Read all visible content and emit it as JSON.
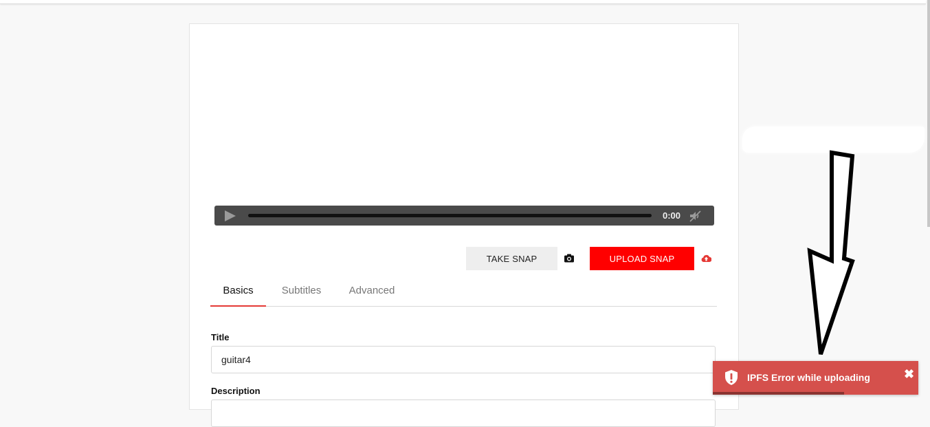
{
  "player": {
    "time": "0:00"
  },
  "actions": {
    "take_snap_label": "TAKE SNAP",
    "upload_snap_label": "UPLOAD SNAP",
    "take_snap_icon": "camera-icon",
    "upload_snap_icon": "cloud-upload-icon"
  },
  "tabs": [
    {
      "label": "Basics",
      "active": true
    },
    {
      "label": "Subtitles",
      "active": false
    },
    {
      "label": "Advanced",
      "active": false
    }
  ],
  "form": {
    "title_label": "Title",
    "title_value": "guitar4",
    "description_label": "Description",
    "description_value": ""
  },
  "toast": {
    "message": "IPFS Error while uploading",
    "icon": "shield-icon",
    "close_icon": "close-icon",
    "progress_remaining": 0.64
  },
  "colors": {
    "accent": "#ff0000",
    "tab_indicator": "#e53935",
    "toast_bg": "#d5504c",
    "player_bg": "#4a4a4a"
  }
}
